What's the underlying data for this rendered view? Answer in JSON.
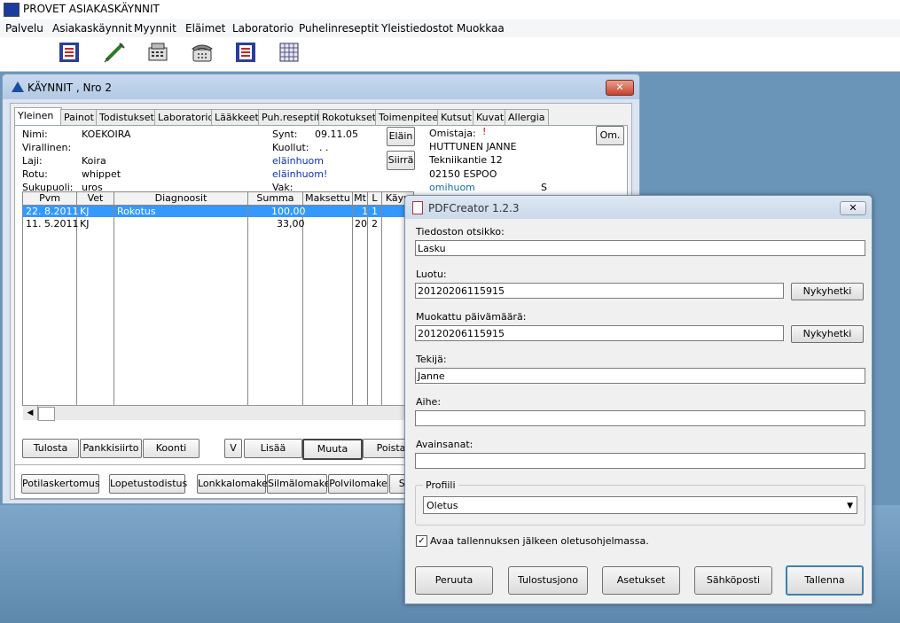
{
  "app": {
    "title": "PROVET ASIAKASKÄYNNIT"
  },
  "menu": [
    "Palvelu",
    "Asiakaskäynnit",
    "Myynnit",
    "Eläimet",
    "Laboratorio",
    "Puhelinreseptit",
    "Yleistiedostot",
    "Muokkaa"
  ],
  "toolbar": [
    "book-icon",
    "syringe-icon",
    "cash-register-icon",
    "telephone-icon",
    "book-icon",
    "grid-icon"
  ],
  "kaynnit": {
    "title": "KÄYNNIT ,  Nro 2",
    "tabs": [
      "Yleinen",
      "Painot",
      "Todistukset",
      "Laboratorio",
      "Lääkkeet",
      "Puh.reseptit",
      "Rokotukset",
      "Toimenpiteet",
      "Kutsut",
      "Kuvat",
      "Allergia"
    ],
    "animal": {
      "nimi_label": "Nimi:",
      "nimi": "KOEKOIRA",
      "virallinen_label": "Virallinen:",
      "laji_label": "Laji:",
      "laji": "Koira",
      "rotu_label": "Rotu:",
      "rotu": "whippet",
      "sukupuoli_label": "Sukupuoli:",
      "sukupuoli": "uros",
      "synt_label": "Synt:",
      "synt": "09.11.05",
      "kuollut_label": "Kuollut:",
      "kuollut": ". .",
      "huom1": "eläinhuom",
      "huom2": "eläinhuom!",
      "vak_label": "Vak:"
    },
    "buttons": {
      "elain": "Eläin",
      "siirra": "Siirrä",
      "om": "Om."
    },
    "owner": {
      "label": "Omistaja:",
      "mark": "!",
      "name": "HUTTUNEN JANNE",
      "street": "Tekniikantie 12",
      "city": "02150  ESPOO",
      "huom": "omihuom",
      "s": "S"
    },
    "grid": {
      "headers": [
        "Pvm",
        "Vet",
        "Diagnoosit",
        "Summa",
        "Maksettu",
        "Mt",
        "L",
        "Käyn"
      ],
      "rows": [
        {
          "pvm": "22. 8.2011",
          "vet": "KJ",
          "diag": "Rokotus",
          "summa": "100,00",
          "maksettu": "",
          "mt": "1",
          "l": "1"
        },
        {
          "pvm": "11. 5.2011",
          "vet": "KJ",
          "diag": "",
          "summa": "33,00",
          "maksettu": "",
          "mt": "20",
          "l": "2"
        }
      ]
    },
    "row_buttons": [
      "Tulosta",
      "Pankkisiirto",
      "Koonti",
      "V",
      "Lisää",
      "Muuta",
      "Poista"
    ],
    "bottom_buttons": [
      "Potilaskertomus",
      "Lopetustodistus",
      "Lonkkalomake",
      "Silmälomake",
      "Polvilomake",
      "Syd"
    ]
  },
  "pdf": {
    "title": "PDFCreator 1.2.3",
    "tiedoston_otsikko_label": "Tiedoston otsikko:",
    "tiedoston_otsikko": "Lasku",
    "luotu_label": "Luotu:",
    "luotu": "20120206115915",
    "muokattu_label": "Muokattu päivämäärä:",
    "muokattu": "20120206115915",
    "nykyhetki": "Nykyhetki",
    "tekija_label": "Tekijä:",
    "tekija": "Janne",
    "aihe_label": "Aihe:",
    "aihe": "",
    "avainsanat_label": "Avainsanat:",
    "avainsanat": "",
    "profiili_label": "Profiili",
    "profiili": "Oletus",
    "checkbox_label": "Avaa tallennuksen jälkeen oletusohjelmassa.",
    "checkbox_checked": true,
    "buttons": [
      "Peruuta",
      "Tulostusjono",
      "Asetukset",
      "Sähköposti",
      "Tallenna"
    ]
  }
}
